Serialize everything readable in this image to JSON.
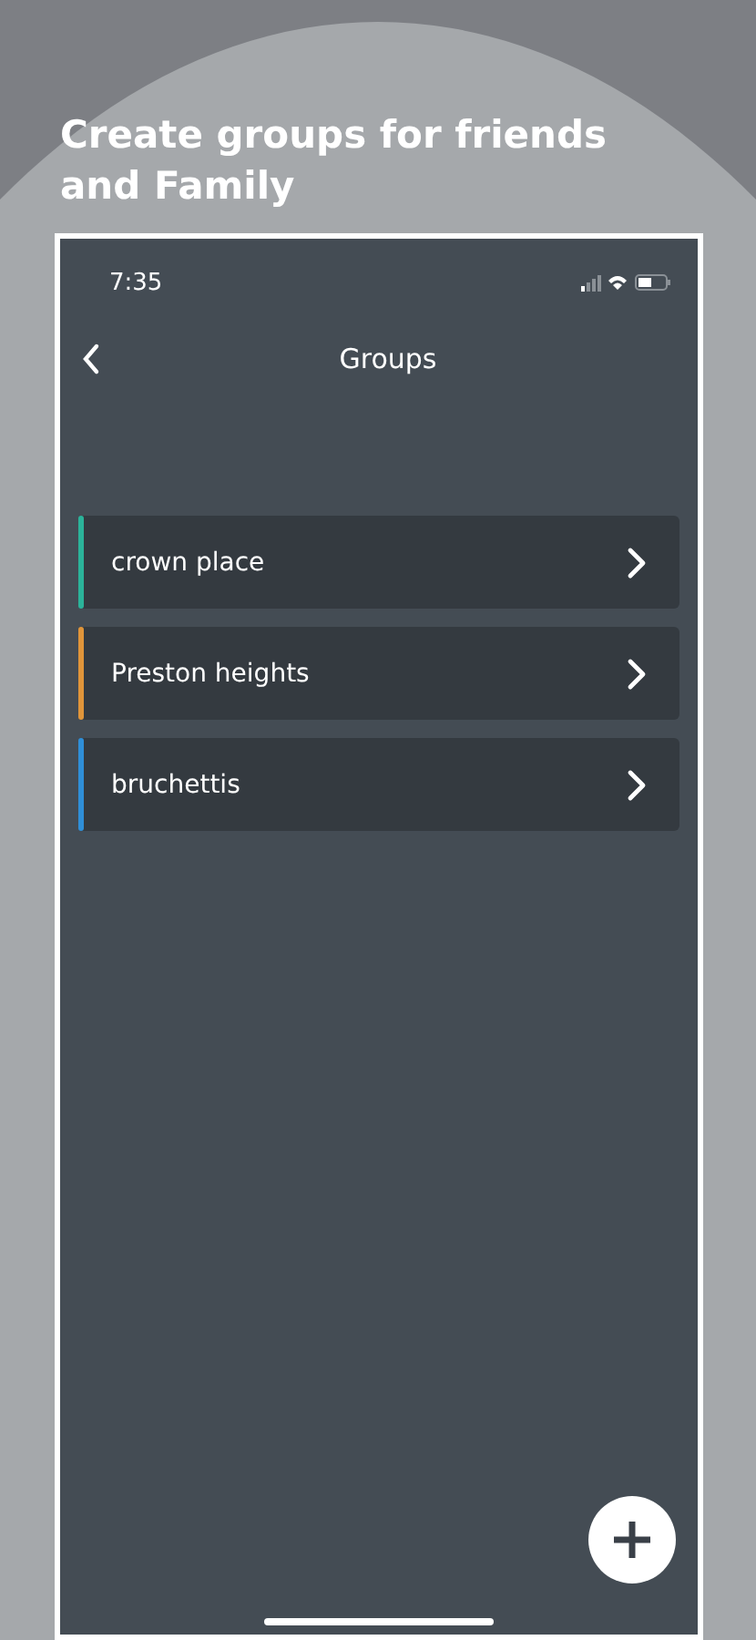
{
  "headline": "Create groups for friends and Family",
  "status_bar": {
    "time": "7:35"
  },
  "nav": {
    "title": "Groups"
  },
  "groups": [
    {
      "name": "crown place",
      "color": "#2bb39a"
    },
    {
      "name": "Preston heights",
      "color": "#e0953a"
    },
    {
      "name": "bruchettis",
      "color": "#2f8fd8"
    }
  ]
}
